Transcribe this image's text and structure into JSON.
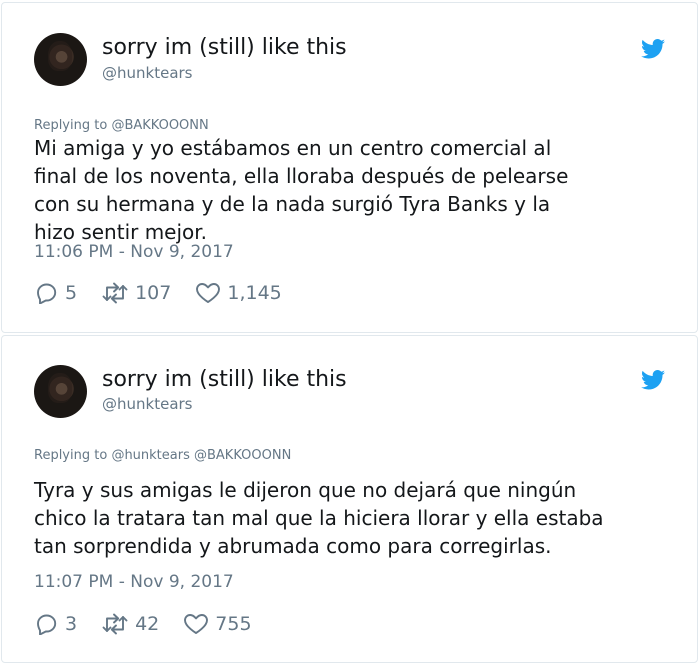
{
  "tweets": [
    {
      "display_name": "sorry im (still) like this",
      "handle": "@hunktears",
      "replying_prefix": "Replying to",
      "replying_to": "@BAKKOOONN",
      "text": "Mi amiga y yo estábamos en un centro comercial al\nfinal de los noventa, ella lloraba después de pelearse\ncon su hermana y de la nada surgió Tyra Banks y la\nhizo sentir mejor.",
      "timestamp": "11:06 PM - Nov 9, 2017",
      "replies": "5",
      "retweets": "107",
      "likes": "1,145"
    },
    {
      "display_name": "sorry im (still) like this",
      "handle": "@hunktears",
      "replying_prefix": "Replying to",
      "replying_to": "@hunktears @BAKKOOONN",
      "text": "Tyra y sus amigas le dijeron que no dejará que ningún\nchico la tratara tan mal que la hiciera llorar y ella estaba\ntan sorprendida y abrumada como para corregirlas.",
      "timestamp": "11:07 PM - Nov 9, 2017",
      "replies": "3",
      "retweets": "42",
      "likes": "755"
    }
  ],
  "icons": {
    "brand": "twitter-bird-icon",
    "reply": "reply-icon",
    "retweet": "retweet-icon",
    "like": "heart-icon"
  },
  "colors": {
    "twitter_blue": "#1da1f2",
    "text": "#14171a",
    "secondary": "#657786",
    "border": "#e1e8ed"
  }
}
